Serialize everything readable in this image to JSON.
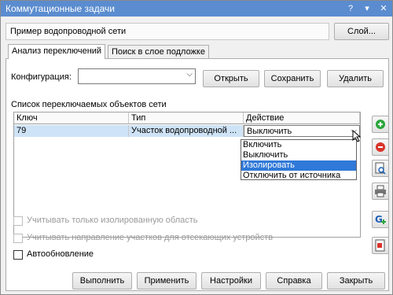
{
  "window": {
    "title": "Коммутационные задачи",
    "help_icon": "?",
    "pin_icon": "▾",
    "close_icon": "✕"
  },
  "map": {
    "name": "Пример водопроводной сети",
    "layer_button": "Слой..."
  },
  "tabs": [
    {
      "label": "Анализ переключений",
      "active": true
    },
    {
      "label": "Поиск в слое подложке",
      "active": false
    }
  ],
  "config": {
    "label": "Конфигурация:",
    "value": "",
    "open_button": "Открыть",
    "save_button": "Сохранить",
    "delete_button": "Удалить"
  },
  "grid": {
    "caption": "Список переключаемых объектов сети",
    "columns": [
      "Ключ",
      "Тип",
      "Действие"
    ],
    "rows": [
      {
        "key": "79",
        "type": "Участок водопроводной ...",
        "action": "Выключить"
      }
    ]
  },
  "action_dropdown": {
    "options": [
      "Включить",
      "Выключить",
      "Изолировать",
      "Отключить от источника"
    ],
    "highlighted_index": 2
  },
  "side_buttons": [
    "add-icon",
    "remove-icon",
    "zoom-to-icon",
    "print-icon",
    "graph-add-icon",
    "report-icon"
  ],
  "options": {
    "isolated_only": {
      "label": "Учитывать только изолированную область",
      "checked": false,
      "enabled": false
    },
    "direction": {
      "label": "Учитывать направление участков для отсекающих устройств",
      "checked": false,
      "enabled": false
    },
    "auto_update": {
      "label": "Автообновление",
      "checked": false,
      "enabled": true
    }
  },
  "footer": {
    "run": "Выполнить",
    "apply": "Применить",
    "settings": "Настройки",
    "help": "Справка",
    "close": "Закрыть"
  },
  "colors": {
    "titlebar": "#5a8ccf",
    "selection": "#3079d8",
    "row_highlight": "#cfe3f6",
    "add_green": "#2aa63a",
    "remove_red": "#d9342b"
  }
}
